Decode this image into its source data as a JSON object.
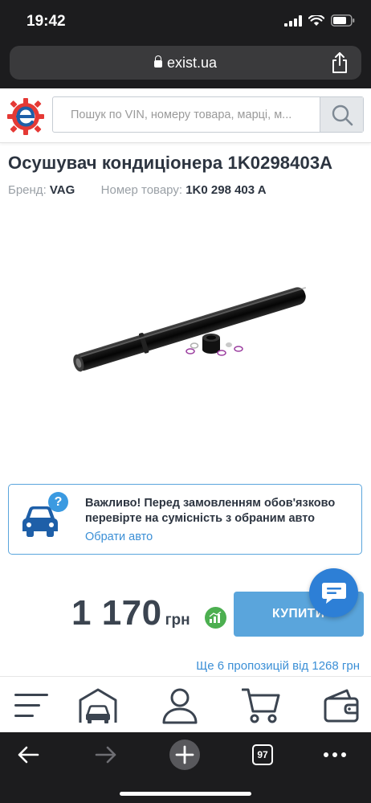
{
  "status_bar": {
    "time": "19:42"
  },
  "browser": {
    "url": "exist.ua",
    "tabs_count": "97"
  },
  "search": {
    "placeholder": "Пошук по VIN, номеру товара, марці, м..."
  },
  "product": {
    "title": "Осушувач кондиціонера 1K0298403A",
    "brand_label": "Бренд:",
    "brand_value": "VAG",
    "number_label": "Номер товару:",
    "number_value": "1K0 298 403 A"
  },
  "notice": {
    "text": "Важливо! Перед замовленням обов'язково перевірте на сумісність з обраним авто",
    "link": "Обрати авто",
    "badge": "?"
  },
  "price": {
    "amount": "1 170",
    "currency": "грн",
    "buy_label": "КУПИТИ",
    "offers": "Ще 6 пропозицій від 1268 грн"
  },
  "colors": {
    "accent_blue": "#5aa5dc",
    "link_blue": "#3b8fd6",
    "brand_red": "#e53935",
    "price_badge_green": "#4caf50",
    "chat_blue": "#2d7fd6"
  },
  "bottom_nav": [
    "menu-icon",
    "garage-icon",
    "user-icon",
    "cart-icon",
    "wallet-icon"
  ],
  "safari_toolbar": [
    "back-icon",
    "forward-icon",
    "new-tab-icon",
    "tabs-icon",
    "more-icon"
  ]
}
